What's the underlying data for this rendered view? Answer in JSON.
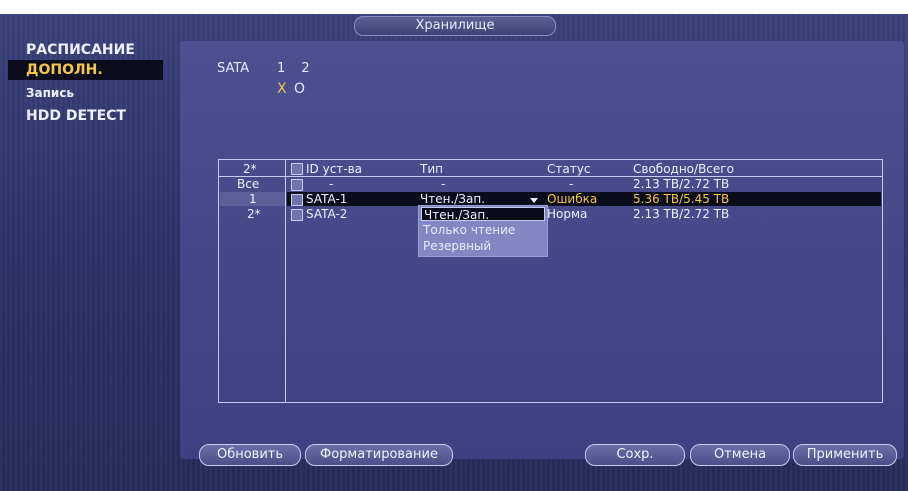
{
  "title": "Хранилище",
  "sidebar": {
    "items": [
      {
        "label": "РАСПИСАНИЕ",
        "active": false
      },
      {
        "label": "ДОПОЛН.",
        "active": true
      },
      {
        "label": "Запись",
        "active": false
      },
      {
        "label": "HDD DETECT",
        "active": false
      }
    ]
  },
  "sata": {
    "label": "SATA",
    "numbers": "1 2",
    "status1": "X",
    "status2": "O"
  },
  "table": {
    "headers": {
      "num": "2*",
      "id": "ID уст-ва",
      "type": "Тип",
      "status": "Статус",
      "free": "Свободно/Всего"
    },
    "rows": [
      {
        "num": "Все",
        "id": "-",
        "type": "-",
        "status": "-",
        "free": "2.13 TB/2.72 TB"
      },
      {
        "num": "1",
        "id": "SATA-1",
        "type": "Чтен./Зап.",
        "status": "Ошибка",
        "free": "5.36 TB/5.45 TB"
      },
      {
        "num": "2*",
        "id": "SATA-2",
        "type": "",
        "status": "Норма",
        "free": "2.13 TB/2.72 TB"
      }
    ]
  },
  "dropdown": {
    "options": [
      "Чтен./Зап.",
      "Только чтение",
      "Резервный"
    ],
    "selected_index": 0
  },
  "buttons": {
    "refresh": "Обновить",
    "format": "Форматирование",
    "save": "Сохр.",
    "cancel": "Отмена",
    "apply": "Применить"
  },
  "colors": {
    "accent": "#f2c84a",
    "panel": "#3d4182"
  }
}
